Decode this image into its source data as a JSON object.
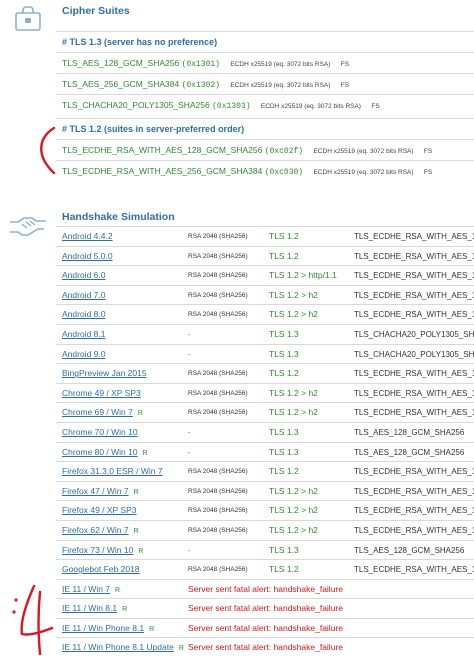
{
  "cipher_section": {
    "title": "Cipher Suites",
    "groups": [
      {
        "header": "# TLS 1.3 (server has no preference)",
        "rows": [
          {
            "suite": "TLS_AES_128_GCM_SHA256",
            "code": "(0x1301)",
            "kx": "ECDH x25519 (eq. 3072 bits RSA)",
            "fs": "FS"
          },
          {
            "suite": "TLS_AES_256_GCM_SHA384",
            "code": "(0x1302)",
            "kx": "ECDH x25519 (eq. 3072 bits RSA)",
            "fs": "FS"
          },
          {
            "suite": "TLS_CHACHA20_POLY1305_SHA256",
            "code": "(0x1303)",
            "kx": "ECDH x25519 (eq. 3072 bits RSA)",
            "fs": "FS"
          }
        ]
      },
      {
        "header": "# TLS 1.2 (suites in server-preferred order)",
        "rows": [
          {
            "suite": "TLS_ECDHE_RSA_WITH_AES_128_GCM_SHA256",
            "code": "(0xc02f)",
            "kx": "ECDH x25519 (eq. 3072 bits RSA)",
            "fs": "FS"
          },
          {
            "suite": "TLS_ECDHE_RSA_WITH_AES_256_GCM_SHA384",
            "code": "(0xc030)",
            "kx": "ECDH x25519 (eq. 3072 bits RSA)",
            "fs": "FS"
          }
        ]
      }
    ]
  },
  "handshake_section": {
    "title": "Handshake Simulation",
    "rows": [
      {
        "client": "Android 4.4.2",
        "r": "",
        "key": "RSA 2048 (SHA256)",
        "proto": "TLS 1.2",
        "cipher": "TLS_ECDHE_RSA_WITH_AES_1"
      },
      {
        "client": "Android 5.0.0",
        "r": "",
        "key": "RSA 2048 (SHA256)",
        "proto": "TLS 1.2",
        "cipher": "TLS_ECDHE_RSA_WITH_AES_1"
      },
      {
        "client": "Android 6.0",
        "r": "",
        "key": "RSA 2048 (SHA256)",
        "proto": "TLS 1.2 > http/1.1",
        "cipher": "TLS_ECDHE_RSA_WITH_AES_1"
      },
      {
        "client": "Android 7.0",
        "r": "",
        "key": "RSA 2048 (SHA256)",
        "proto": "TLS 1.2 > h2",
        "cipher": "TLS_ECDHE_RSA_WITH_AES_1"
      },
      {
        "client": "Android 8.0",
        "r": "",
        "key": "RSA 2048 (SHA256)",
        "proto": "TLS 1.2 > h2",
        "cipher": "TLS_ECDHE_RSA_WITH_AES_1"
      },
      {
        "client": "Android 8.1",
        "r": "",
        "key": "-",
        "proto": "TLS 1.3",
        "cipher": "TLS_CHACHA20_POLY1305_SHA"
      },
      {
        "client": "Android 9.0",
        "r": "",
        "key": "-",
        "proto": "TLS 1.3",
        "cipher": "TLS_CHACHA20_POLY1305_SHA"
      },
      {
        "client": "BingPreview Jan 2015",
        "r": "",
        "key": "RSA 2048 (SHA256)",
        "proto": "TLS 1.2",
        "cipher": "TLS_ECDHE_RSA_WITH_AES_1"
      },
      {
        "client": "Chrome 49 / XP SP3",
        "r": "",
        "key": "RSA 2048 (SHA256)",
        "proto": "TLS 1.2 > h2",
        "cipher": "TLS_ECDHE_RSA_WITH_AES_1"
      },
      {
        "client": "Chrome 69 / Win 7",
        "r": "R",
        "key": "RSA 2048 (SHA256)",
        "proto": "TLS 1.2 > h2",
        "cipher": "TLS_ECDHE_RSA_WITH_AES_1"
      },
      {
        "client": "Chrome 70 / Win 10",
        "r": "",
        "key": "-",
        "proto": "TLS 1.3",
        "cipher": "TLS_AES_128_GCM_SHA256"
      },
      {
        "client": "Chrome 80 / Win 10",
        "r": "R",
        "key": "-",
        "proto": "TLS 1.3",
        "cipher": "TLS_AES_128_GCM_SHA256"
      },
      {
        "client": "Firefox 31.3.0 ESR / Win 7",
        "r": "",
        "key": "RSA 2048 (SHA256)",
        "proto": "TLS 1.2",
        "cipher": "TLS_ECDHE_RSA_WITH_AES_1"
      },
      {
        "client": "Firefox 47 / Win 7",
        "r": "R",
        "key": "RSA 2048 (SHA256)",
        "proto": "TLS 1.2 > h2",
        "cipher": "TLS_ECDHE_RSA_WITH_AES_1"
      },
      {
        "client": "Firefox 49 / XP SP3",
        "r": "",
        "key": "RSA 2048 (SHA256)",
        "proto": "TLS 1.2 > h2",
        "cipher": "TLS_ECDHE_RSA_WITH_AES_1"
      },
      {
        "client": "Firefox 62 / Win 7",
        "r": "R",
        "key": "RSA 2048 (SHA256)",
        "proto": "TLS 1.2 > h2",
        "cipher": "TLS_ECDHE_RSA_WITH_AES_1"
      },
      {
        "client": "Firefox 73 / Win 10",
        "r": "R",
        "key": "-",
        "proto": "TLS 1.3",
        "cipher": "TLS_AES_128_GCM_SHA256"
      },
      {
        "client": "Googlebot Feb 2018",
        "r": "",
        "key": "RSA 2048 (SHA256)",
        "proto": "TLS 1.2",
        "cipher": "TLS_ECDHE_RSA_WITH_AES_1"
      },
      {
        "client": "IE 11 / Win 7",
        "r": "R",
        "fail": "Server sent fatal alert: handshake_failure"
      },
      {
        "client": "IE 11 / Win 8.1",
        "r": "R",
        "fail": "Server sent fatal alert: handshake_failure"
      },
      {
        "client": "IE 11 / Win Phone 8.1",
        "r": "R",
        "fail": "Server sent fatal alert: handshake_failure"
      },
      {
        "client": "IE 11 / Win Phone 8.1 Update",
        "r": "R",
        "fail": "Server sent fatal alert: handshake_failure"
      }
    ]
  },
  "icons": {
    "cipher": "lock-briefcase-icon",
    "handshake": "handshake-icon"
  },
  "colors": {
    "heading": "#2f6fa6",
    "ok": "#2e8b2e",
    "fail": "#d31818",
    "annotation": "#e0141e"
  }
}
